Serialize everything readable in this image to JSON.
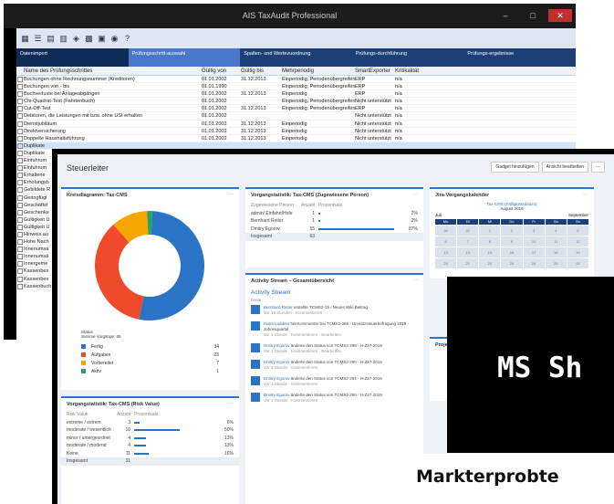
{
  "back_window": {
    "title": "AIS TaxAudit Professional",
    "controls": [
      "–",
      "□",
      "✕"
    ],
    "toolbar_icons": [
      "grid-icon",
      "list-icon",
      "table-icon",
      "filter-icon",
      "binoculars-icon",
      "chart-icon",
      "calc-icon",
      "globe-icon",
      "help-icon"
    ],
    "wizard_steps": [
      "Datenimport",
      "Prüfungsschritt-auswahl",
      "Spalten- und Wertezuordnung",
      "Prüfungs-durchführung",
      "Prüfungs-ergebnisse"
    ],
    "columns": [
      "Name des Prüfungsschrittes",
      "Gültig von",
      "Gültig bis",
      "Mehrperiodig",
      "SmartExporter",
      "Kritikalität"
    ],
    "rows": [
      {
        "name": "Buchungen ohne Rechnungsnummer (Kreditoren)",
        "von": "01.01.2002",
        "bis": "31.12.2013",
        "mehr": "Einperiodig, Periodenübergreifend",
        "smart": "ERP",
        "krit": "n/a"
      },
      {
        "name": "Buchungen von - bis",
        "von": "01.01.1990",
        "bis": "",
        "mehr": "Einperiodig, Periodenübergreifend",
        "smart": "ERP",
        "krit": "n/a"
      },
      {
        "name": "Buchverluste bei Anlageabgängen",
        "von": "01.01.2002",
        "bis": "31.12.2013",
        "mehr": "Einperiodig",
        "smart": "ERP",
        "krit": "n/a"
      },
      {
        "name": "Chi-Quadrat-Test (Fahrtenbuch)",
        "von": "01.01.2002",
        "bis": "",
        "mehr": "Einperiodig, Periodenübergreifend",
        "smart": "Nicht unterstützt",
        "krit": "n/a"
      },
      {
        "name": "Cut-Off-Test",
        "von": "01.01.2002",
        "bis": "31.12.2013",
        "mehr": "Einperiodig, Periodenübergreifend",
        "smart": "ERP",
        "krit": "n/a"
      },
      {
        "name": "Debitoren, die Leistungen mit bzw. ohne USt erhalten",
        "von": "01.01.2002",
        "bis": "",
        "mehr": "",
        "smart": "Nicht unterstützt",
        "krit": "n/a"
      },
      {
        "name": "Dienstjubiläum",
        "von": "01.01.2002",
        "bis": "31.12.2013",
        "mehr": "Einperiodig",
        "smart": "Nicht unterstützt",
        "krit": "n/a"
      },
      {
        "name": "Direktversicherung",
        "von": "01.01.2002",
        "bis": "31.12.2013",
        "mehr": "Einperiodig",
        "smart": "Nicht unterstützt",
        "krit": "n/a"
      },
      {
        "name": "Doppelte Haushaltsführung",
        "von": "01.01.2002",
        "bis": "31.12.2013",
        "mehr": "Einperiodig",
        "smart": "Nicht unterstützt",
        "krit": "n/a"
      },
      {
        "name": "Duplikate",
        "von": "",
        "bis": "",
        "mehr": "",
        "smart": "",
        "krit": ""
      },
      {
        "name": "Duplikate",
        "von": "",
        "bis": "",
        "mehr": "",
        "smart": "",
        "krit": ""
      },
      {
        "name": "Einfuhrum",
        "von": "",
        "bis": "",
        "mehr": "",
        "smart": "",
        "krit": ""
      },
      {
        "name": "Einfuhrum",
        "von": "",
        "bis": "",
        "mehr": "",
        "smart": "",
        "krit": ""
      },
      {
        "name": "Erhaltene",
        "von": "",
        "bis": "",
        "mehr": "",
        "smart": "",
        "krit": ""
      },
      {
        "name": "Erholungsb",
        "von": "",
        "bis": "",
        "mehr": "",
        "smart": "",
        "krit": ""
      },
      {
        "name": "Gebildete R",
        "von": "",
        "bis": "",
        "mehr": "",
        "smart": "",
        "krit": ""
      },
      {
        "name": "Geringfügi",
        "von": "",
        "bis": "",
        "mehr": "",
        "smart": "",
        "krit": ""
      },
      {
        "name": "Geschäftsf",
        "von": "",
        "bis": "",
        "mehr": "",
        "smart": "",
        "krit": ""
      },
      {
        "name": "Geschenke",
        "von": "",
        "bis": "",
        "mehr": "",
        "smart": "",
        "krit": ""
      },
      {
        "name": "Gültigkeit U",
        "von": "",
        "bis": "",
        "mehr": "",
        "smart": "",
        "krit": ""
      },
      {
        "name": "Gültigkeit U",
        "von": "",
        "bis": "",
        "mehr": "",
        "smart": "",
        "krit": ""
      },
      {
        "name": "Hinweis au",
        "von": "",
        "bis": "",
        "mehr": "",
        "smart": "",
        "krit": ""
      },
      {
        "name": "Hohe Nach",
        "von": "",
        "bis": "",
        "mehr": "",
        "smart": "",
        "krit": ""
      },
      {
        "name": "Innenumsä",
        "von": "",
        "bis": "",
        "mehr": "",
        "smart": "",
        "krit": ""
      },
      {
        "name": "Innenumsä",
        "von": "",
        "bis": "",
        "mehr": "",
        "smart": "",
        "krit": ""
      },
      {
        "name": "Innergeme",
        "von": "",
        "bis": "",
        "mehr": "",
        "smart": "",
        "krit": ""
      },
      {
        "name": "Kassenbes",
        "von": "",
        "bis": "",
        "mehr": "",
        "smart": "",
        "krit": ""
      },
      {
        "name": "Kassenbes",
        "von": "",
        "bis": "",
        "mehr": "",
        "smart": "",
        "krit": ""
      },
      {
        "name": "Kassenbuch",
        "von": "",
        "bis": "",
        "mehr": "",
        "smart": "",
        "krit": ""
      }
    ]
  },
  "front": {
    "title": "Steuerleiter",
    "buttons": [
      "Gadget hinzufügen",
      "Ansicht bearbeiten",
      "···"
    ],
    "donut": {
      "title": "Kreisdiagramm: Tax-CMS",
      "caption1": "Status",
      "caption2": "Summe Vorgänge: 65"
    },
    "colors": {
      "fertig": "#2b73c6",
      "aufgaben": "#f04a2a",
      "vorbereitet": "#f5a700",
      "aktiv": "#2ba360",
      "accent": "#2b73c6",
      "header": "#1d3f78"
    },
    "vorgang1": {
      "title": "Vorgangstatistik: Tax-CMS (Zugewiesene Person)",
      "headers": [
        "Zugewiesene Person",
        "Anzahl",
        "Prozentsatz"
      ],
      "rows": [
        {
          "name": "admin/ Einfahrt/Hofe",
          "count": "1",
          "pct": "2%"
        },
        {
          "name": "Bernhard Reiter",
          "count": "1",
          "pct": "2%"
        },
        {
          "name": "Dmitry Egorov",
          "count": "55",
          "pct": "87%"
        }
      ],
      "total_label": "Insgesamt",
      "total": "63"
    },
    "calendar": {
      "title": "Jira-Vorgangskalender",
      "subtitle": "Tax-CMS (Fälligkeitsdatum)",
      "month": "August 2018",
      "prev": "Juli",
      "next": "September",
      "days": [
        "Mo",
        "Di",
        "Mi",
        "Do",
        "Fr",
        "Sa",
        "So"
      ],
      "cells": [
        "30",
        "31",
        "1",
        "2",
        "3",
        "4",
        "5",
        "6",
        "7",
        "8",
        "9",
        "10",
        "11",
        "12",
        "13",
        "14",
        "15",
        "16",
        "17",
        "18",
        "19",
        "20",
        "21",
        "22",
        "23",
        "24",
        "25",
        "26"
      ]
    },
    "stream": {
      "title": "Activity Stream – Gesamtübersicht",
      "header": "Activity Stream",
      "sub": "heute",
      "items": [
        {
          "who": "Bernhard Reiter",
          "text": "erstellte TCMS2-15 - Neues Wiki Beitrag",
          "meta": "Vor 19 Stunden · Kommentieren"
        },
        {
          "who": "Dana Lüdders",
          "text": "hat Kommentar bei TCMS2-368 - Umsatzsteuerbefragung 2018 - Jahresquartal",
          "meta": "Vor 1 Stunde · Kommentieren · Bearbeiten"
        },
        {
          "who": "Dmitry Egorov",
          "text": "änderte den Status von TCMS2-288 - H-Z27-2019",
          "meta": "Vor 1 Stunde · Kommentieren · Bearbeiten"
        },
        {
          "who": "Dmitry Egorov",
          "text": "änderte den Status von TCMS2-290 - H-Z27-2019",
          "meta": "Vor 1 Stunde · Kommentieren"
        },
        {
          "who": "Dmitry Egorov",
          "text": "änderte den Status von TCMS2-294 - H-Z27-2019",
          "meta": "Vor 1 Stunde · Kommentieren"
        },
        {
          "who": "Dmitry Egorov",
          "text": "änderte den Status von TCMS2-290 - H-Z27-2019",
          "meta": "Vor 1 Stunde · Kommentieren"
        }
      ]
    },
    "risk": {
      "title": "Vorgangstatistik: Tax-CMS (Risk Value)",
      "headers": [
        "Risk Value",
        "Anzahl",
        "Prozentsatz"
      ],
      "rows": [
        {
          "name": "extreme / extrem",
          "count": "3",
          "pct": "6%"
        },
        {
          "name": "moderate / wesentlich",
          "count": "10",
          "pct": "50%"
        },
        {
          "name": "minor / untergeordnet",
          "count": "4",
          "pct": "13%"
        },
        {
          "name": "moderate / moderat",
          "count": "4",
          "pct": "13%"
        },
        {
          "name": "Keine",
          "count": "11",
          "pct": "16%"
        }
      ],
      "total_label": "Insgesamt",
      "total": "31"
    },
    "projects_label": "Projekt"
  },
  "chart_data": {
    "type": "pie",
    "title": "Kreisdiagramm: Tax-CMS",
    "categories": [
      "Fertig",
      "Aufgaben",
      "Vorbereitet",
      "Aktiv"
    ],
    "values": [
      34,
      23,
      7,
      1
    ]
  },
  "banner": {
    "text": "MS Sh",
    "footer": "Markterprobte"
  }
}
